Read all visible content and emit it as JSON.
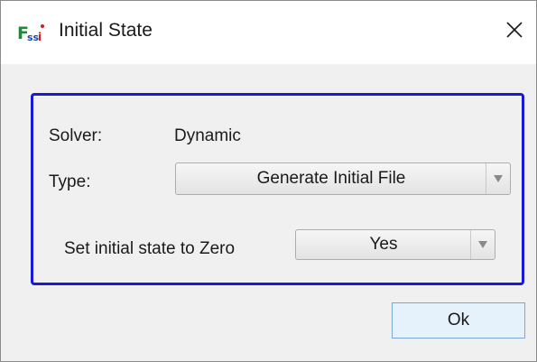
{
  "window": {
    "title": "Initial State",
    "app_icon": "fssi-logo-icon",
    "close_icon": "close-icon"
  },
  "form": {
    "solver_label": "Solver:",
    "solver_value": "Dynamic",
    "type_label": "Type:",
    "type_selected": "Generate Initial File",
    "zero_label": "Set initial state to Zero",
    "zero_selected": "Yes"
  },
  "buttons": {
    "ok_label": "Ok"
  },
  "colors": {
    "group_border": "#1a1ad6",
    "dialog_background": "#f0f0f0",
    "ok_button_fill": "#e5f1fb",
    "ok_button_border": "#7aa7d6"
  }
}
